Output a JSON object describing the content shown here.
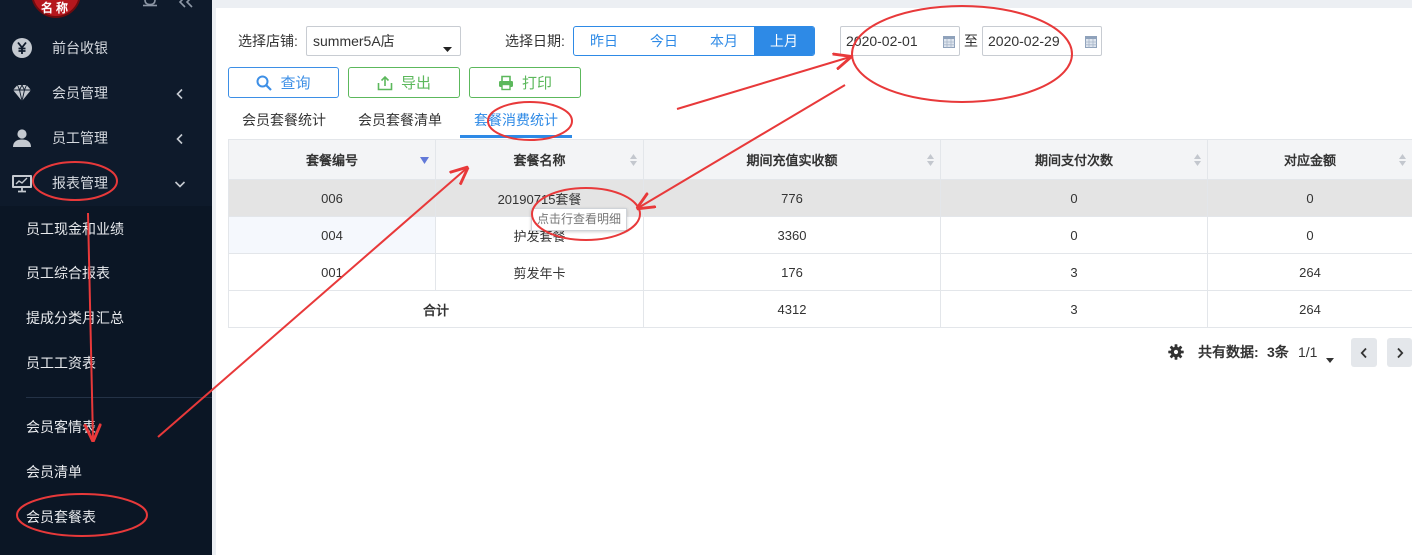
{
  "logo": {
    "text": "名称"
  },
  "sidebar": {
    "top_icons": [
      "bell-icon",
      "collapse-icon"
    ],
    "menu": [
      {
        "label": "前台收银",
        "icon": "yen-coin-icon"
      },
      {
        "label": "会员管理",
        "icon": "diamond-icon",
        "state_icon": "chevron-left-icon"
      },
      {
        "label": "员工管理",
        "icon": "user-icon",
        "state_icon": "chevron-left-icon"
      },
      {
        "label": "报表管理",
        "icon": "monitor-icon",
        "state_icon": "chevron-down-icon",
        "expanded": true
      }
    ],
    "submenu": [
      {
        "label": "员工现金和业绩"
      },
      {
        "label": "员工综合报表"
      },
      {
        "label": "提成分类月汇总"
      },
      {
        "label": "员工工资表"
      },
      {
        "label": "会员客情表"
      },
      {
        "label": "会员清单"
      },
      {
        "label": "会员套餐表"
      }
    ]
  },
  "filters": {
    "store_label": "选择店铺:",
    "store_value": "summer5A店",
    "date_label": "选择日期:",
    "quick_dates": [
      "昨日",
      "今日",
      "本月",
      "上月"
    ],
    "quick_active_index": 3,
    "date_from": "2020-02-01",
    "range_separator": "至",
    "date_to": "2020-02-29"
  },
  "actions": {
    "query": {
      "label": "查询",
      "icon": "search-icon"
    },
    "export": {
      "label": "导出",
      "icon": "export-icon"
    },
    "print": {
      "label": "打印",
      "icon": "printer-icon"
    }
  },
  "tabs": [
    {
      "label": "会员套餐统计",
      "active": false
    },
    {
      "label": "会员套餐清单",
      "active": false
    },
    {
      "label": "套餐消费统计",
      "active": true
    }
  ],
  "table": {
    "columns": [
      "套餐编号",
      "套餐名称",
      "期间充值实收额",
      "期间支付次数",
      "对应金额"
    ],
    "sort": {
      "column_index": 0,
      "descending": true
    },
    "rows": [
      [
        "006",
        "20190715套餐",
        "776",
        "0",
        "0"
      ],
      [
        "004",
        "护发套餐",
        "3360",
        "0",
        "0"
      ],
      [
        "001",
        "剪发年卡",
        "176",
        "3",
        "264"
      ]
    ],
    "total": {
      "label": "合计",
      "recharge": "4312",
      "payments": "3",
      "amount": "264"
    }
  },
  "tooltip": "点击行查看明细",
  "pagination": {
    "total_label": "共有数据:",
    "total_count": "3条",
    "page": "1/1"
  },
  "colors": {
    "sidebar_bg": "#0e1a2b",
    "accent_blue": "#2e8ae6",
    "accent_green": "#5cb85c",
    "logo_red": "#b5171d",
    "annotation_red": "#e8393a"
  }
}
